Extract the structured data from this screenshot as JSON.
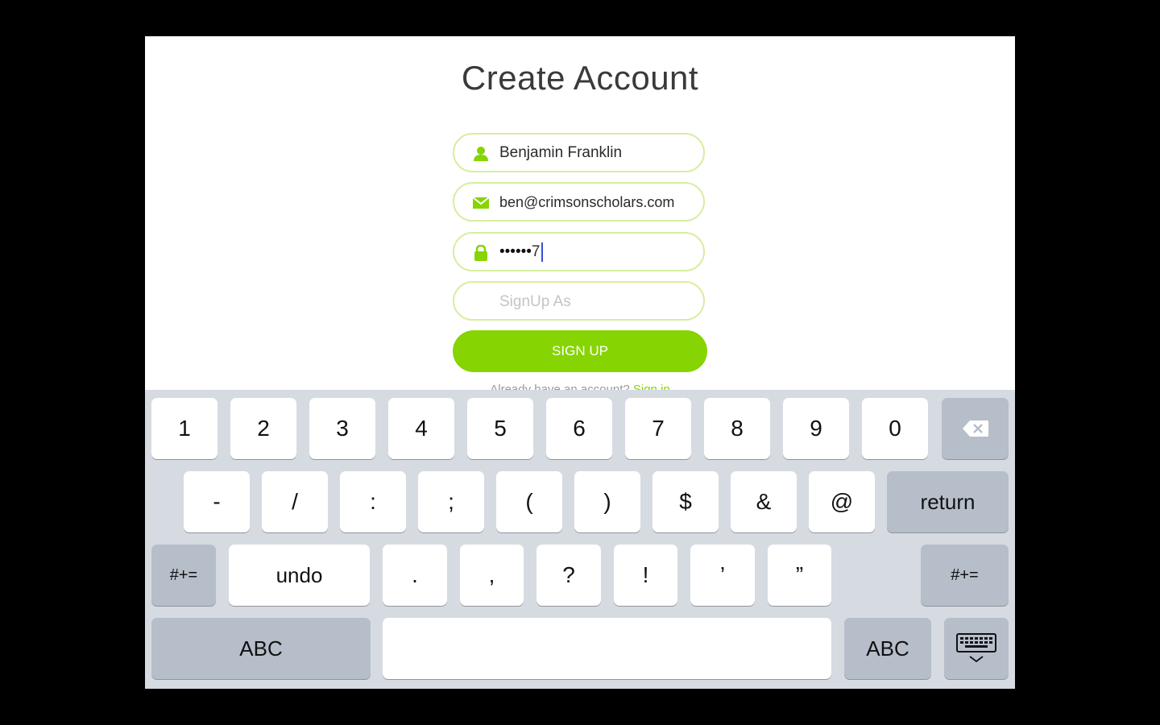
{
  "page": {
    "title": "Create Account",
    "name_value": "Benjamin Franklin",
    "email_value": "ben@crimsonscholars.com",
    "password_masked": "••••••",
    "password_last_char": "7",
    "signup_as_placeholder": "SignUp As",
    "signup_button": "SIGN UP",
    "already_text": "Already have an account?",
    "signin_link": "Sign in",
    "accent_color": "#86d401"
  },
  "keyboard": {
    "row1": [
      "1",
      "2",
      "3",
      "4",
      "5",
      "6",
      "7",
      "8",
      "9",
      "0"
    ],
    "row2": [
      "-",
      "/",
      ":",
      ";",
      "(",
      ")",
      "$",
      "&",
      "@"
    ],
    "return_label": "return",
    "row3_left_mod": "#+=",
    "undo_label": "undo",
    "row3_symbols": [
      ".",
      ",",
      "?",
      "!",
      "’",
      "”"
    ],
    "row3_right_mod": "#+=",
    "abc_left": "ABC",
    "abc_right": "ABC",
    "backspace_icon": "backspace-icon",
    "hide_keyboard_icon": "keyboard-hide-icon"
  }
}
